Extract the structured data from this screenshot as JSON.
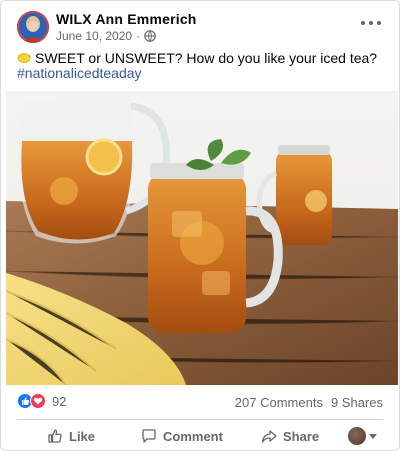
{
  "post": {
    "author": "WILX Ann Emmerich",
    "date": "June 10, 2020",
    "privacy_icon": "globe-icon",
    "text": "SWEET or UNSWEET? How do you like your iced tea?",
    "emoji_icon": "lemon-icon",
    "hashtag": "#nationalicedteaday",
    "image_icon": "iced-tea-photo"
  },
  "reactions": {
    "types": [
      "like-icon",
      "love-icon"
    ],
    "count": "92"
  },
  "stats": {
    "comments": "207 Comments",
    "shares": "9 Shares"
  },
  "actions": {
    "like": "Like",
    "comment": "Comment",
    "share": "Share"
  },
  "colors": {
    "hashtag": "#385898",
    "like_blue": "#1877f2",
    "love_red": "#f33e58",
    "muted": "#65676b"
  }
}
